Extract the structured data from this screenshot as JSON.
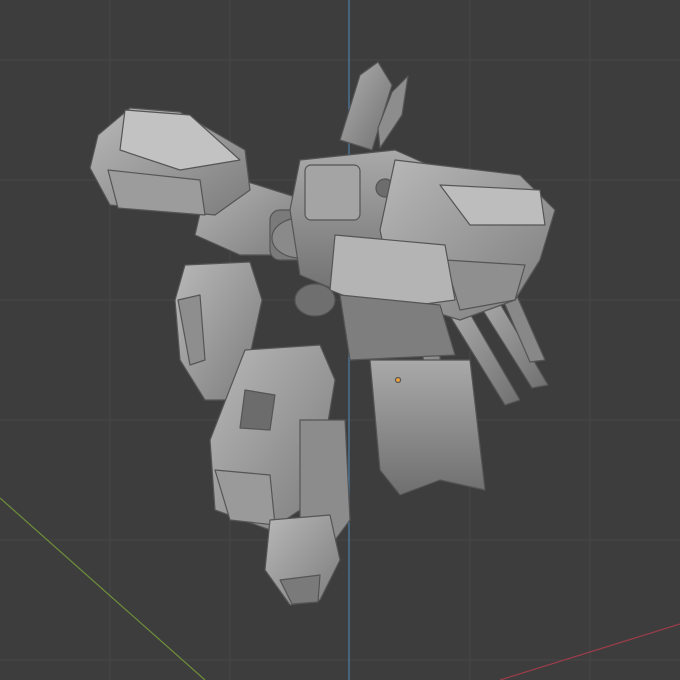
{
  "viewport": {
    "background": "#3d3d3d",
    "grid_color": "#474747",
    "axis_x_color": "#9a3d4a",
    "axis_y_color": "#6e8f3a",
    "axis_z_color": "#4d7fa8",
    "origin_color": "#f2a33a"
  },
  "model": {
    "kind": "sculpted-mecha-figure",
    "shading": "solid",
    "base_color": "#9a9a9a"
  }
}
